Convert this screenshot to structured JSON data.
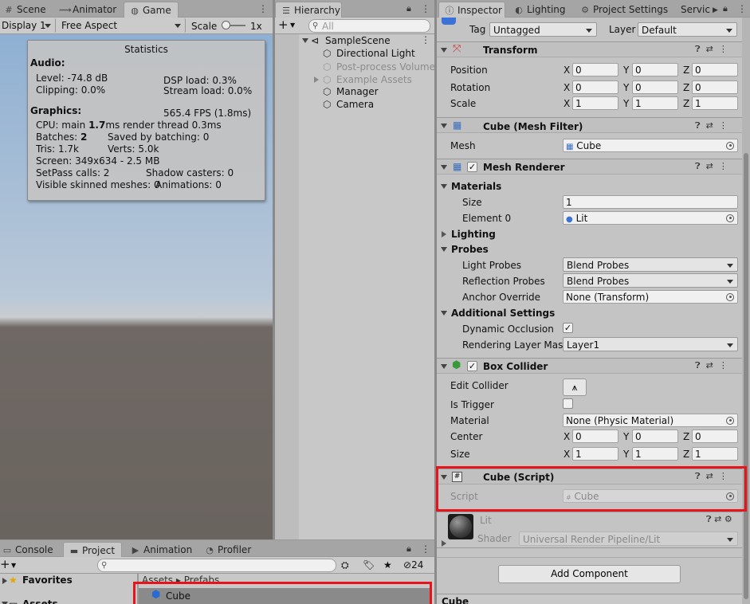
{
  "game_panel": {
    "tabs": [
      {
        "label": "Scene",
        "icon": "hash-icon"
      },
      {
        "label": "Animator",
        "icon": "animator-icon"
      },
      {
        "label": "Game",
        "icon": "gamepad-icon",
        "active": true
      }
    ],
    "display": "Display 1",
    "aspect": "Free Aspect",
    "scale_label": "Scale",
    "scale_value": "1x"
  },
  "statistics": {
    "title": "Statistics",
    "audio_title": "Audio:",
    "level": "Level: -74.8 dB",
    "dsp": "DSP load: 0.3%",
    "clipping": "Clipping: 0.0%",
    "stream": "Stream load: 0.0%",
    "graphics_title": "Graphics:",
    "fps": "565.4 FPS (1.8ms)",
    "cpu_a": "CPU: main ",
    "cpu_b": "1.7",
    "cpu_c": "ms  render thread 0.3ms",
    "batches_a": "Batches: ",
    "batches_b": "2",
    "saved": "Saved by batching: 0",
    "tris": "Tris: 1.7k",
    "verts": "Verts: 5.0k",
    "screen": "Screen: 349x634 - 2.5 MB",
    "setpass": "SetPass calls: 2",
    "shadow": "Shadow casters: 0",
    "skinned": "Visible skinned meshes: 0",
    "animations": "Animations: 0"
  },
  "hierarchy": {
    "tab": "Hierarchy",
    "search_placeholder": "All",
    "scene": "SampleScene",
    "items": [
      {
        "label": "Directional Light",
        "dim": false
      },
      {
        "label": "Post-process Volume",
        "dim": true
      },
      {
        "label": "Example Assets",
        "dim": true
      },
      {
        "label": "Manager",
        "dim": false
      },
      {
        "label": "Camera",
        "dim": false
      }
    ]
  },
  "inspector": {
    "tabs": [
      "Inspector",
      "Lighting",
      "Project Settings",
      "Servic"
    ],
    "tag_label": "Tag",
    "tag_value": "Untagged",
    "layer_label": "Layer",
    "layer_value": "Default",
    "transform": {
      "title": "Transform",
      "position": "Position",
      "rotation": "Rotation",
      "scale": "Scale",
      "pos": [
        "0",
        "0",
        "0"
      ],
      "rot": [
        "0",
        "0",
        "0"
      ],
      "scl": [
        "1",
        "1",
        "1"
      ],
      "axis": [
        "X",
        "Y",
        "Z"
      ]
    },
    "mesh_filter": {
      "title": "Cube (Mesh Filter)",
      "mesh_label": "Mesh",
      "mesh_value": "Cube"
    },
    "mesh_renderer": {
      "title": "Mesh Renderer",
      "materials": "Materials",
      "size_label": "Size",
      "size_value": "1",
      "element_label": "Element 0",
      "element_value": "Lit",
      "lighting": "Lighting",
      "probes": "Probes",
      "light_probes": "Light Probes",
      "light_probes_value": "Blend Probes",
      "reflection_probes": "Reflection Probes",
      "reflection_probes_value": "Blend Probes",
      "anchor": "Anchor Override",
      "anchor_value": "None (Transform)",
      "additional": "Additional Settings",
      "dynamic": "Dynamic Occlusion",
      "rlm": "Rendering Layer Mask",
      "rlm_value": "Layer1"
    },
    "box_collider": {
      "title": "Box Collider",
      "edit": "Edit Collider",
      "trigger": "Is Trigger",
      "material": "Material",
      "material_value": "None (Physic Material)",
      "center": "Center",
      "center_vals": [
        "0",
        "0",
        "0"
      ],
      "size": "Size",
      "size_vals": [
        "1",
        "1",
        "1"
      ]
    },
    "cube_script": {
      "title": "Cube (Script)",
      "script_label": "Script",
      "script_value": "Cube"
    },
    "material": {
      "name": "Lit",
      "shader_label": "Shader",
      "shader_value": "Universal Render Pipeline/Lit"
    },
    "add_component": "Add Component",
    "footer": "Cube"
  },
  "project": {
    "tabs": [
      {
        "label": "Console",
        "icon": "console-icon"
      },
      {
        "label": "Project",
        "icon": "folder-icon",
        "active": true
      },
      {
        "label": "Animation",
        "icon": "animation-icon"
      },
      {
        "label": "Profiler",
        "icon": "profiler-icon"
      }
    ],
    "favorites": "Favorites",
    "assets": "Assets",
    "breadcrumb_a": "Assets",
    "breadcrumb_sep": "▸",
    "breadcrumb_b": "Prefabs",
    "asset_item": "Cube",
    "hidden_count": "24"
  },
  "colors": {
    "highlight": "#e8141c",
    "accent_blue": "#3a72d8"
  }
}
